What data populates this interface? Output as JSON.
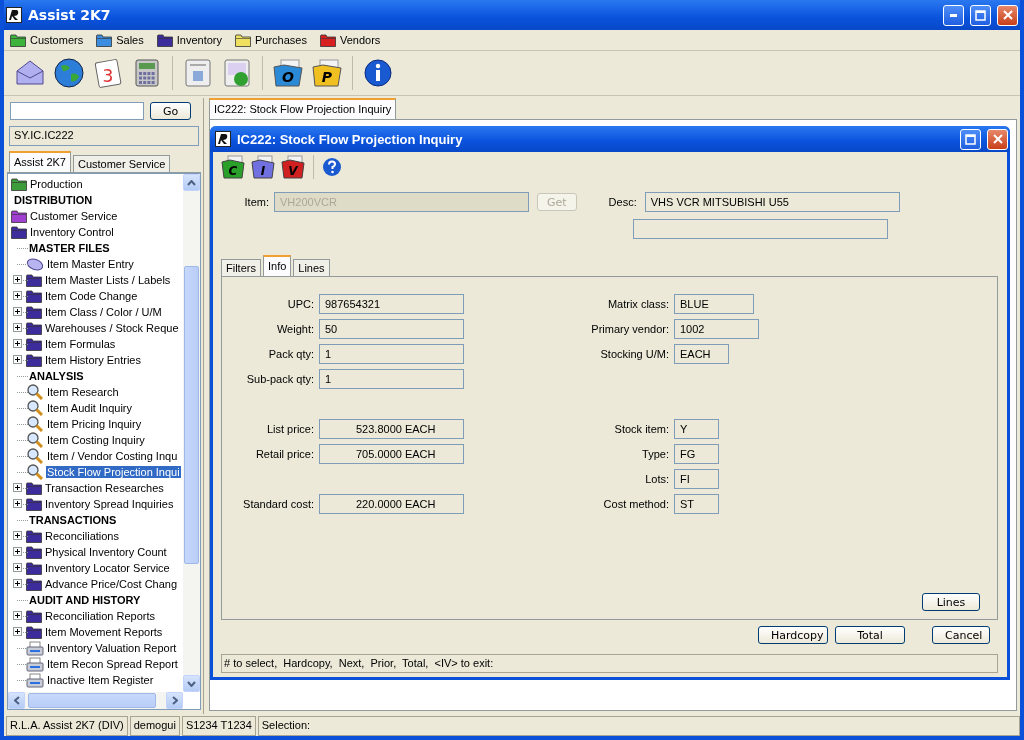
{
  "window": {
    "title": "Assist 2K7"
  },
  "menu": [
    {
      "label": "Customers",
      "color": "#3cb43c"
    },
    {
      "label": "Sales",
      "color": "#3c8ce0"
    },
    {
      "label": "Inventory",
      "color": "#3c2c9c"
    },
    {
      "label": "Purchases",
      "color": "#f0e060"
    },
    {
      "label": "Vendors",
      "color": "#d82020"
    }
  ],
  "toolbar": [
    {
      "kind": "mail"
    },
    {
      "kind": "globe"
    },
    {
      "kind": "calendar",
      "label": "3"
    },
    {
      "kind": "calculator"
    },
    {
      "kind": "sep"
    },
    {
      "kind": "contact"
    },
    {
      "kind": "sheet"
    },
    {
      "kind": "sep"
    },
    {
      "kind": "folder",
      "label": "O",
      "color": "#2a8ad8"
    },
    {
      "kind": "folder",
      "label": "P",
      "color": "#f0c020"
    },
    {
      "kind": "sep"
    },
    {
      "kind": "info"
    }
  ],
  "sidebar": {
    "go": "Go",
    "path": "SY.IC.IC222",
    "tabs": [
      {
        "label": "Assist 2K7",
        "selected": true
      },
      {
        "label": "Customer Service",
        "selected": false
      }
    ],
    "tree": [
      {
        "label": "Production",
        "kind": "folder",
        "color": "#3c9c3c",
        "selected": false
      },
      {
        "label": "DISTRIBUTION",
        "kind": "section",
        "selected": false
      },
      {
        "label": "Customer Service",
        "kind": "folder",
        "color": "#a040d0",
        "selected": false
      },
      {
        "label": "Inventory Control",
        "kind": "folder",
        "color": "#3c2c9c",
        "selected": false,
        "children": [
          {
            "label": "MASTER FILES",
            "kind": "section",
            "selected": false
          },
          {
            "label": "Item Master Entry",
            "kind": "entry",
            "selected": false
          },
          {
            "label": "Item Master Lists / Labels",
            "kind": "group",
            "selected": false
          },
          {
            "label": "Item Code Change",
            "kind": "group",
            "selected": false
          },
          {
            "label": "Item Class / Color / U/M",
            "kind": "group",
            "selected": false
          },
          {
            "label": "Warehouses / Stock Reque",
            "kind": "group",
            "selected": false
          },
          {
            "label": "Item Formulas",
            "kind": "group",
            "selected": false
          },
          {
            "label": "Item History Entries",
            "kind": "group",
            "selected": false
          },
          {
            "label": "ANALYSIS",
            "kind": "section",
            "selected": false
          },
          {
            "label": "Item Research",
            "kind": "inquiry",
            "selected": false
          },
          {
            "label": "Item Audit Inquiry",
            "kind": "inquiry",
            "selected": false
          },
          {
            "label": "Item Pricing Inquiry",
            "kind": "inquiry",
            "selected": false
          },
          {
            "label": "Item Costing Inquiry",
            "kind": "inquiry",
            "selected": false
          },
          {
            "label": "Item / Vendor Costing Inqu",
            "kind": "inquiry",
            "selected": false
          },
          {
            "label": "Stock Flow Projection Inqui",
            "kind": "inquiry",
            "selected": true
          },
          {
            "label": "Transaction Researches",
            "kind": "group",
            "selected": false
          },
          {
            "label": "Inventory Spread Inquiries",
            "kind": "group",
            "selected": false
          },
          {
            "label": "TRANSACTIONS",
            "kind": "section",
            "selected": false
          },
          {
            "label": "Reconciliations",
            "kind": "group",
            "selected": false
          },
          {
            "label": "Physical Inventory Count",
            "kind": "group",
            "selected": false
          },
          {
            "label": "Inventory Locator Service",
            "kind": "group",
            "selected": false
          },
          {
            "label": "Advance Price/Cost Chang",
            "kind": "group",
            "selected": false
          },
          {
            "label": "AUDIT AND HISTORY",
            "kind": "section",
            "selected": false
          },
          {
            "label": "Reconciliation Reports",
            "kind": "group",
            "selected": false
          },
          {
            "label": "Item Movement Reports",
            "kind": "group",
            "selected": false
          },
          {
            "label": "Inventory Valuation Report",
            "kind": "report",
            "selected": false
          },
          {
            "label": "Item Recon Spread Report",
            "kind": "report",
            "selected": false
          },
          {
            "label": "Inactive Item Register",
            "kind": "report",
            "selected": false
          }
        ]
      }
    ]
  },
  "doc_tabs": [
    {
      "label": "IC222: Stock Flow Projection Inquiry",
      "selected": true
    }
  ],
  "dialog": {
    "title": "IC222: Stock Flow Projection Inquiry",
    "tools": [
      {
        "label": "C",
        "color": "#2aa02a"
      },
      {
        "label": "I",
        "color": "#7070e0"
      },
      {
        "label": "V",
        "color": "#d02020"
      }
    ],
    "item_label": "Item:",
    "item_value": "VH200VCR",
    "item_disabled": true,
    "get": "Get",
    "get_disabled": true,
    "desc_label": "Desc:",
    "desc_value": "VHS VCR MITSUBISHI U55",
    "tabs": [
      {
        "label": "Filters",
        "selected": false
      },
      {
        "label": "Info",
        "selected": true
      },
      {
        "label": "Lines",
        "selected": false
      }
    ],
    "sections": [
      {
        "kind": "general",
        "rows": [
          {
            "left": {
              "label": "UPC:",
              "value": "987654321"
            },
            "right": {
              "label": "Matrix class:",
              "value": "BLUE"
            }
          },
          {
            "left": {
              "label": "Weight:",
              "value": "50"
            },
            "right": {
              "label": "Primary vendor:",
              "value": "1002"
            }
          },
          {
            "left": {
              "label": "Pack qty:",
              "value": "1"
            },
            "right": {
              "label": "Stocking U/M:",
              "value": "EACH"
            }
          },
          {
            "left": {
              "label": "Sub-pack qty:",
              "value": "1"
            }
          }
        ]
      },
      {
        "kind": "pricing",
        "rows": [
          {
            "left": {
              "label": "List price:",
              "value": "523.8000 EACH"
            },
            "right": {
              "label": "Stock item:",
              "value": "Y"
            }
          },
          {
            "left": {
              "label": "Retail price:",
              "value": "705.0000 EACH"
            },
            "right": {
              "label": "Type:",
              "value": "FG"
            }
          },
          {
            "right": {
              "label": "Lots:",
              "value": "FI"
            }
          },
          {
            "left": {
              "label": "Standard cost:",
              "value": "220.0000 EACH"
            },
            "right": {
              "label": "Cost method:",
              "value": "ST"
            }
          }
        ]
      }
    ],
    "lines_button": "Lines",
    "buttons": [
      "Hardcopy",
      "Total",
      "Cancel"
    ],
    "message": "# to select,  Hardcopy,  Next,  Prior,  Total,  <IV> to exit:"
  },
  "status_bar": [
    "R.L.A. Assist 2K7 (DIV)",
    "demogui",
    "S1234 T1234",
    "Selection:"
  ]
}
